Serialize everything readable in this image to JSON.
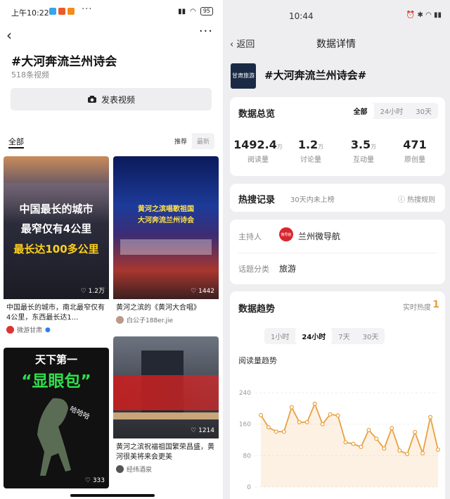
{
  "left": {
    "status": {
      "time": "上午10:22",
      "dots": "···",
      "battery": "95"
    },
    "title": "#大河奔流兰州诗会",
    "subtitle": "518条视频",
    "publish_label": "发表视频",
    "tab_all": "全部",
    "sort_recommend": "推荐",
    "sort_latest": "最新",
    "cards": [
      {
        "cap1": "中国最长的城市",
        "cap2": "最窄仅有4公里",
        "cap3": "最长达100多公里",
        "likes": "1.2万",
        "text": "中国最长的城市，南北最窄仅有4公里，东西最长达1...",
        "author": "微游甘肃"
      },
      {
        "cap1": "黄河之滨唱歌祖国",
        "cap2": "大河奔流兰州诗会",
        "likes": "1442",
        "text": "黄河之滨的《黄河大合唱》",
        "author": "白公子188er.jie"
      },
      {
        "cap1": "天下第一",
        "cap2": "“显眼包”",
        "cap3": "哈哈哈",
        "likes": "333"
      },
      {
        "likes": "1214",
        "text": "黄河之滨祝福祖国繁荣昌盛，黄河很美将来会更美",
        "author": "经纬酒泉"
      }
    ]
  },
  "right": {
    "status": {
      "time": "10:44"
    },
    "back": "返回",
    "title": "数据详情",
    "logo_text": "甘肃旅游",
    "topic": "#大河奔流兰州诗会#",
    "overview": {
      "header": "数据总览",
      "ranges": [
        "全部",
        "24小时",
        "30天"
      ],
      "stats": [
        {
          "value": "1492.4",
          "unit": "万",
          "label": "阅读量"
        },
        {
          "value": "1.2",
          "unit": "万",
          "label": "讨论量"
        },
        {
          "value": "3.5",
          "unit": "万",
          "label": "互动量"
        },
        {
          "value": "471",
          "unit": "",
          "label": "原创量"
        }
      ]
    },
    "hot": {
      "header": "热搜记录",
      "note": "30天内未上榜",
      "rule": "热搜规则"
    },
    "host": {
      "label": "主持人",
      "name": "兰州微导航",
      "badge": "微导航"
    },
    "category": {
      "label": "话题分类",
      "value": "旅游"
    },
    "trend": {
      "header": "数据趋势",
      "realtime": "实时热度",
      "realtime_value": "1",
      "ranges": [
        "1小时",
        "24小时",
        "7天",
        "30天"
      ],
      "chart_title": "阅读量趋势"
    },
    "colors": {
      "accent": "#e8a140"
    }
  },
  "chart_data": {
    "type": "area",
    "title": "阅读量趋势",
    "ylim": [
      0,
      240
    ],
    "yticks": [
      0,
      80,
      160,
      240
    ],
    "values": [
      183,
      152,
      141,
      141,
      203,
      165,
      165,
      212,
      160,
      185,
      182,
      114,
      110,
      102,
      145,
      123,
      98,
      150,
      93,
      84,
      140,
      86,
      178,
      95
    ]
  }
}
